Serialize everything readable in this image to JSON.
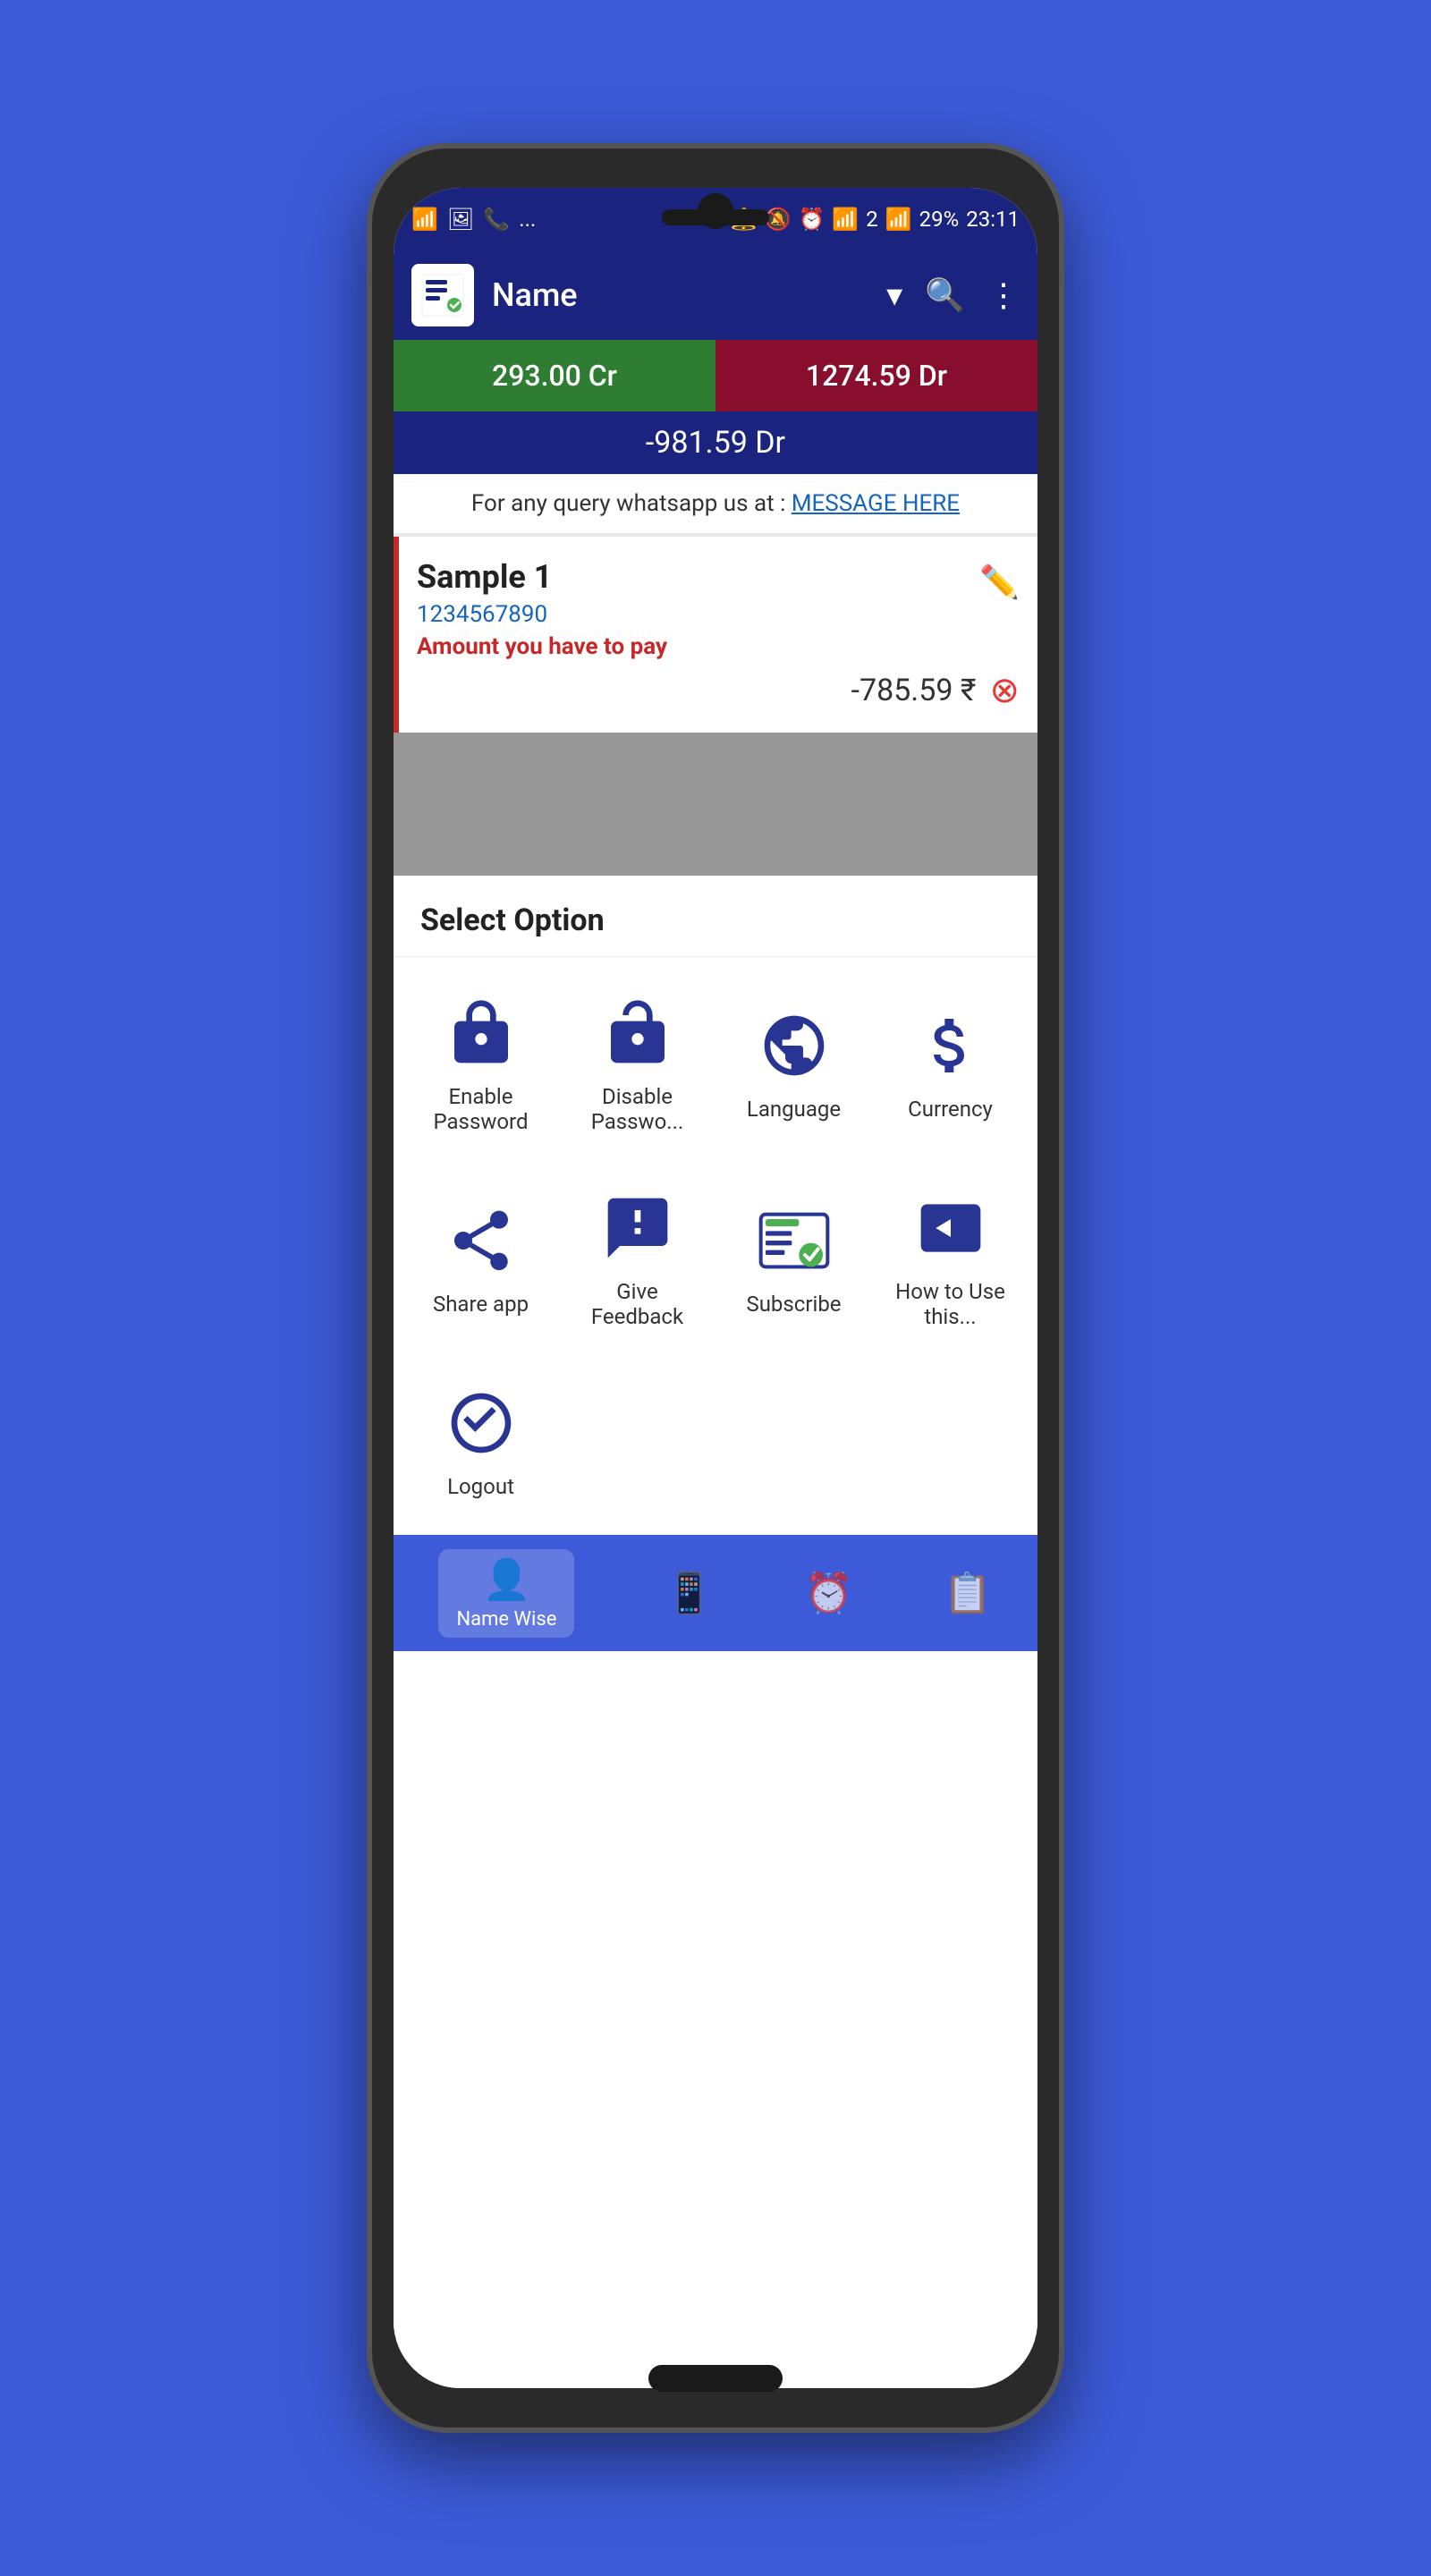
{
  "background_color": "#3d5bd9",
  "status_bar": {
    "left_icons": "📶 🖼 📞 ...",
    "battery": "29%",
    "time": "23:11",
    "right_icons": "🔔 🔕 ⏰ 📶 2 📶 📶"
  },
  "header": {
    "title": "Name",
    "search_icon": "search",
    "menu_icon": "more-vert",
    "dropdown_icon": "arrow-drop-down"
  },
  "balance": {
    "credit": "293.00 Cr",
    "debit": "1274.59 Dr",
    "total": "-981.59 Dr"
  },
  "query_bar": {
    "text": "For any query whatsapp us at :",
    "link_text": "MESSAGE HERE"
  },
  "contact": {
    "name": "Sample 1",
    "phone": "1234567890",
    "status": "Amount you have to pay",
    "amount": "-785.59 ₹"
  },
  "bottom_sheet": {
    "title": "Select Option",
    "options": [
      {
        "id": "enable-password",
        "label": "Enable Password",
        "icon": "lock"
      },
      {
        "id": "disable-password",
        "label": "Disable Passwo...",
        "icon": "lock-open"
      },
      {
        "id": "language",
        "label": "Language",
        "icon": "globe"
      },
      {
        "id": "currency",
        "label": "Currency",
        "icon": "dollar"
      },
      {
        "id": "share-app",
        "label": "Share app",
        "icon": "share"
      },
      {
        "id": "give-feedback",
        "label": "Give Feedback",
        "icon": "feedback"
      },
      {
        "id": "subscribe",
        "label": "Subscribe",
        "icon": "subscribe"
      },
      {
        "id": "how-to-use",
        "label": "How to Use this...",
        "icon": "video"
      },
      {
        "id": "logout",
        "label": "Logout",
        "icon": "logout"
      }
    ]
  },
  "bottom_nav": {
    "items": [
      {
        "id": "name-wise",
        "label": "Name Wise",
        "active": true
      },
      {
        "id": "item2",
        "label": "",
        "active": false
      },
      {
        "id": "item3",
        "label": "",
        "active": false
      },
      {
        "id": "item4",
        "label": "",
        "active": false
      }
    ]
  }
}
